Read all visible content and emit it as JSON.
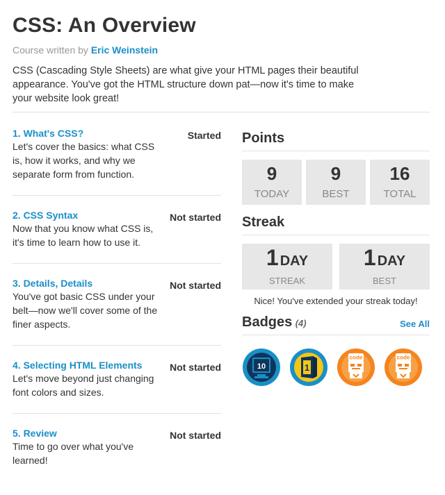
{
  "course": {
    "title": "CSS: An Overview",
    "byline_prefix": "Course written by",
    "author": "Eric Weinstein",
    "description": "CSS (Cascading Style Sheets) are what give your HTML pages their beautiful appearance. You've got the HTML structure down pat—now it's time to make your website look great!"
  },
  "lessons": [
    {
      "title": "1. What's CSS?",
      "description": "Let's cover the basics: what CSS is, how it works, and why we separate form from function.",
      "status": "Started"
    },
    {
      "title": "2. CSS Syntax",
      "description": "Now that you know what CSS is, it's time to learn how to use it.",
      "status": "Not started"
    },
    {
      "title": "3. Details, Details",
      "description": "You've got basic CSS under your belt—now we'll cover some of the finer aspects.",
      "status": "Not started"
    },
    {
      "title": "4. Selecting HTML Elements",
      "description": "Let's move beyond just changing font colors and sizes.",
      "status": "Not started"
    },
    {
      "title": "5. Review",
      "description": "Time to go over what you've learned!",
      "status": "Not started"
    }
  ],
  "points": {
    "heading": "Points",
    "items": [
      {
        "value": "9",
        "label": "TODAY"
      },
      {
        "value": "9",
        "label": "BEST"
      },
      {
        "value": "16",
        "label": "TOTAL"
      }
    ]
  },
  "streak": {
    "heading": "Streak",
    "items": [
      {
        "value": "1",
        "unit": "DAY",
        "label": "STREAK"
      },
      {
        "value": "1",
        "unit": "DAY",
        "label": "BEST"
      }
    ],
    "message": "Nice! You've extended your streak today!"
  },
  "badges": {
    "heading": "Badges",
    "count": "(4)",
    "see_all": "See All",
    "items": [
      {
        "icon": "ten-exercises-badge-icon",
        "text": "10"
      },
      {
        "icon": "first-lesson-badge-icon",
        "text": "1"
      },
      {
        "icon": "code-robot-badge-icon",
        "text": "code"
      },
      {
        "icon": "code-robot-badge-icon",
        "text": "code"
      }
    ]
  },
  "colors": {
    "link": "#1a8fc7",
    "stat_box": "#e7e7e7",
    "badge_blue": "#1a8fc7",
    "badge_orange": "#f5841f"
  }
}
